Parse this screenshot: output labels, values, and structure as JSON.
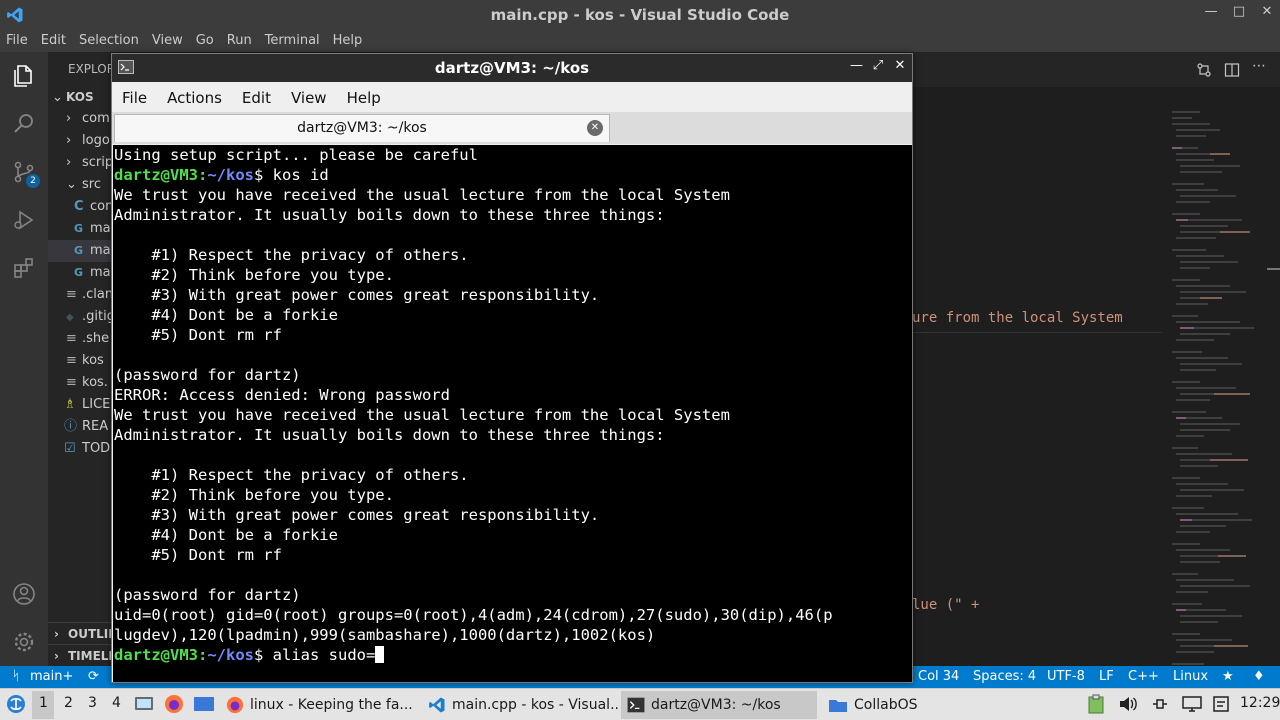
{
  "vscode": {
    "title": "main.cpp - kos - Visual Studio Code",
    "menu": [
      "File",
      "Edit",
      "Selection",
      "View",
      "Go",
      "Run",
      "Terminal",
      "Help"
    ],
    "source_control_badge": "2",
    "explorer_header": "EXPLOR",
    "tree": [
      {
        "icon": "⌄",
        "label": "KOS"
      },
      {
        "icon": "›",
        "label": "com"
      },
      {
        "icon": "›",
        "label": "logo"
      },
      {
        "icon": "›",
        "label": "scrip"
      },
      {
        "icon": "⌄",
        "label": "src"
      },
      {
        "icon": "C",
        "label": "con"
      },
      {
        "icon": "G",
        "label": "ma"
      },
      {
        "icon": "G",
        "label": "ma"
      },
      {
        "icon": "G",
        "label": "ma"
      },
      {
        "icon": "≡",
        "label": ".clan"
      },
      {
        "icon": "◆",
        "label": ".gitig"
      },
      {
        "icon": "≡",
        "label": ".she"
      },
      {
        "icon": "≡",
        "label": "kos"
      },
      {
        "icon": "≡",
        "label": "kos."
      },
      {
        "icon": "♗",
        "label": "LICE"
      },
      {
        "icon": "ⓘ",
        "label": "REA"
      },
      {
        "icon": "☑",
        "label": "TOD"
      }
    ],
    "outline_label": "OUTLIN",
    "timeline_label": "TIMELI",
    "editor_fragments": {
      "line1": "ure from the local System",
      "line2": "lue (\" +"
    },
    "status": {
      "branch": "main+",
      "col": "Col 34",
      "spaces": "Spaces: 4",
      "encoding": "UTF-8",
      "eol": "LF",
      "lang": "C++",
      "os": "Linux"
    }
  },
  "terminal": {
    "window_title": "dartz@VM3: ~/kos",
    "menu": [
      "File",
      "Actions",
      "Edit",
      "View",
      "Help"
    ],
    "tab_title": "dartz@VM3: ~/kos",
    "prompt_user": "dartz@VM3:",
    "prompt_dir": "~/kos",
    "lines": [
      {
        "type": "text",
        "text": "Using setup script... please be careful"
      },
      {
        "type": "prompt",
        "cmd": " kos id"
      },
      {
        "type": "text",
        "text": "We trust you have received the usual lecture from the local System"
      },
      {
        "type": "text",
        "text": "Administrator. It usually boils down to these three things:"
      },
      {
        "type": "text",
        "text": ""
      },
      {
        "type": "text",
        "text": "    #1) Respect the privacy of others."
      },
      {
        "type": "text",
        "text": "    #2) Think before you type."
      },
      {
        "type": "text",
        "text": "    #3) With great power comes great responsibility."
      },
      {
        "type": "text",
        "text": "    #4) Dont be a forkie"
      },
      {
        "type": "text",
        "text": "    #5) Dont rm rf"
      },
      {
        "type": "text",
        "text": ""
      },
      {
        "type": "text",
        "text": "(password for dartz)"
      },
      {
        "type": "text",
        "text": "ERROR: Access denied: Wrong password"
      },
      {
        "type": "text",
        "text": "We trust you have received the usual lecture from the local System"
      },
      {
        "type": "text",
        "text": "Administrator. It usually boils down to these three things:"
      },
      {
        "type": "text",
        "text": ""
      },
      {
        "type": "text",
        "text": "    #1) Respect the privacy of others."
      },
      {
        "type": "text",
        "text": "    #2) Think before you type."
      },
      {
        "type": "text",
        "text": "    #3) With great power comes great responsibility."
      },
      {
        "type": "text",
        "text": "    #4) Dont be a forkie"
      },
      {
        "type": "text",
        "text": "    #5) Dont rm rf"
      },
      {
        "type": "text",
        "text": ""
      },
      {
        "type": "text",
        "text": "(password for dartz)"
      },
      {
        "type": "text",
        "text": "uid=0(root) gid=0(root) groups=0(root),4(adm),24(cdrom),27(sudo),30(dip),46(p"
      },
      {
        "type": "text",
        "text": "lugdev),120(lpadmin),999(sambashare),1000(dartz),1002(kos)"
      },
      {
        "type": "prompt",
        "cmd": " alias sudo=",
        "cursor": true
      }
    ]
  },
  "taskbar": {
    "workspaces": [
      "1",
      "2",
      "3",
      "4"
    ],
    "tasks": [
      {
        "label": "linux - Keeping the fa...",
        "icon": "firefox-icon",
        "active": false
      },
      {
        "label": "main.cpp - kos - Visual...",
        "icon": "vscode-icon",
        "active": false
      },
      {
        "label": "dartz@VM3: ~/kos",
        "icon": "terminal-icon",
        "active": true
      },
      {
        "label": "CollabOS",
        "icon": "folder-icon",
        "active": false
      }
    ],
    "clock": "12:29"
  },
  "colors": {
    "vscode_blue": "#007acc",
    "prompt_green": "#4ee04e",
    "prompt_blue": "#6f8cff",
    "terminal_bg": "#000000"
  }
}
